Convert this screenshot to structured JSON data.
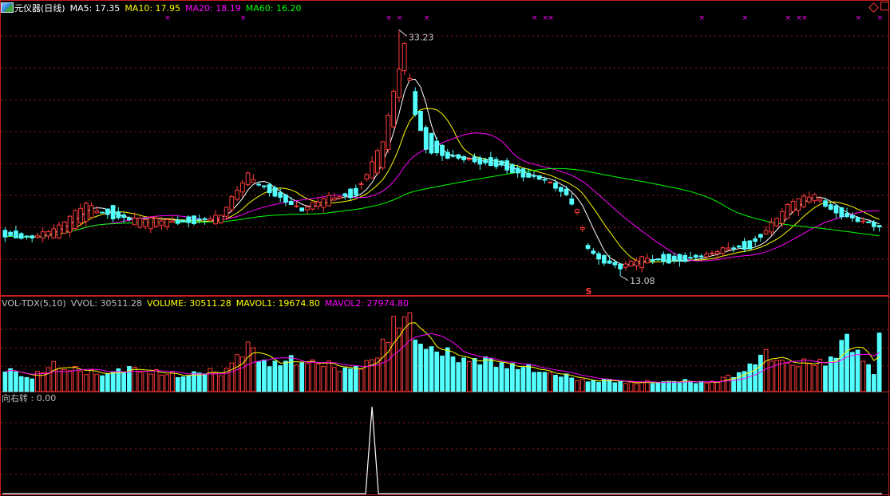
{
  "main_panel": {
    "title": "元仪器(日线)",
    "indicators": [
      {
        "label": "MA5: 17.35",
        "color": "#ffffff"
      },
      {
        "label": "MA10: 17.95",
        "color": "#ffff00"
      },
      {
        "label": "MA20: 18.19",
        "color": "#ff00ff"
      },
      {
        "label": "MA60: 16.20",
        "color": "#00ff00"
      }
    ],
    "high_label": "33.23",
    "low_label": "13.08",
    "marker_label": "S"
  },
  "volume_panel": {
    "indicators": [
      {
        "label": "VOL-TDX(5,10)",
        "color": "#c0c0c0"
      },
      {
        "label": "VVOL: 30511.28",
        "color": "#c0c0c0"
      },
      {
        "label": "VOLUME: 30511.28",
        "color": "#ffff00"
      },
      {
        "label": "MAVOL1: 19674.80",
        "color": "#ffff00"
      },
      {
        "label": "MAVOL2: 27974.80",
        "color": "#ff00ff"
      }
    ]
  },
  "signal_panel": {
    "label": "向右转 : 0.00"
  },
  "chart_data": {
    "type": "candlestick",
    "series": [
      {
        "name": "MA5",
        "color": "#ffffff"
      },
      {
        "name": "MA10",
        "color": "#ffff00"
      },
      {
        "name": "MA20",
        "color": "#ff00ff"
      },
      {
        "name": "MA60",
        "color": "#00ff00"
      }
    ],
    "price_range": [
      11.5,
      34.5
    ],
    "latest": {
      "MA5": 17.35,
      "MA10": 17.95,
      "MA20": 18.19,
      "MA60": 16.2,
      "VOLUME": 30511.28,
      "MAVOL1": 19674.8,
      "MAVOL2": 27974.8,
      "signal": 0.0
    },
    "highest_price": 33.23,
    "lowest_price": 13.08,
    "up_color": "#ff3b3b",
    "down_color": "#54ffff",
    "ohlc_anchors": [
      [
        0,
        16.8,
        16.3
      ],
      [
        5,
        16.1,
        16.4
      ],
      [
        10,
        16.4,
        17.0
      ],
      [
        15,
        17.6,
        19.0
      ],
      [
        20,
        18.6,
        18.0
      ],
      [
        25,
        17.2,
        17.6
      ],
      [
        30,
        17.2,
        17.6
      ],
      [
        35,
        17.8,
        17.6
      ],
      [
        40,
        17.5,
        17.9
      ],
      [
        45,
        20.6,
        21.4
      ],
      [
        50,
        20.2,
        19.8
      ],
      [
        55,
        18.7,
        18.3
      ],
      [
        60,
        18.8,
        19.6
      ],
      [
        65,
        20.2,
        19.8
      ],
      [
        70,
        22.0,
        24.0
      ],
      [
        72,
        25.4,
        28.0
      ],
      [
        74,
        30.0,
        32.0
      ],
      [
        76,
        28.0,
        26.5
      ],
      [
        78,
        25.0,
        23.6
      ],
      [
        82,
        23.2,
        22.8
      ],
      [
        88,
        22.8,
        22.2
      ],
      [
        92,
        22.4,
        22.2
      ],
      [
        96,
        21.7,
        21.3
      ],
      [
        100,
        21.2,
        20.8
      ],
      [
        104,
        20.2,
        19.6
      ],
      [
        106,
        18.2,
        18.6
      ],
      [
        108,
        15.3,
        15.6
      ],
      [
        110,
        14.8,
        14.5
      ],
      [
        114,
        14.1,
        13.6
      ],
      [
        118,
        13.9,
        14.5
      ],
      [
        122,
        14.6,
        14.4
      ],
      [
        126,
        14.7,
        14.4
      ],
      [
        130,
        14.9,
        14.6
      ],
      [
        134,
        15.1,
        15.4
      ],
      [
        138,
        15.8,
        15.5
      ],
      [
        142,
        16.8,
        17.3
      ],
      [
        146,
        18.4,
        19.1
      ],
      [
        150,
        19.2,
        19.8
      ],
      [
        154,
        18.7,
        18.3
      ],
      [
        158,
        17.9,
        17.5
      ],
      [
        162,
        17.4,
        16.9
      ]
    ],
    "volume_anchors": [
      [
        0,
        12000
      ],
      [
        5,
        8000
      ],
      [
        10,
        16000
      ],
      [
        15,
        10000
      ],
      [
        20,
        11000
      ],
      [
        25,
        13000
      ],
      [
        30,
        9000
      ],
      [
        35,
        10000
      ],
      [
        40,
        11000
      ],
      [
        45,
        24000
      ],
      [
        50,
        15000
      ],
      [
        55,
        18000
      ],
      [
        60,
        14000
      ],
      [
        65,
        13000
      ],
      [
        68,
        16000
      ],
      [
        70,
        30000
      ],
      [
        72,
        38000
      ],
      [
        74,
        40000
      ],
      [
        76,
        33000
      ],
      [
        78,
        25000
      ],
      [
        82,
        20000
      ],
      [
        88,
        17000
      ],
      [
        92,
        16000
      ],
      [
        96,
        13000
      ],
      [
        100,
        11000
      ],
      [
        104,
        8000
      ],
      [
        108,
        6000
      ],
      [
        112,
        6000
      ],
      [
        116,
        5000
      ],
      [
        120,
        5000
      ],
      [
        124,
        6000
      ],
      [
        128,
        5000
      ],
      [
        132,
        6000
      ],
      [
        136,
        10000
      ],
      [
        140,
        20000
      ],
      [
        144,
        17000
      ],
      [
        148,
        15000
      ],
      [
        152,
        17000
      ],
      [
        156,
        28000
      ],
      [
        160,
        15000
      ],
      [
        162,
        8000
      ]
    ],
    "signal_peak_index": 68
  }
}
